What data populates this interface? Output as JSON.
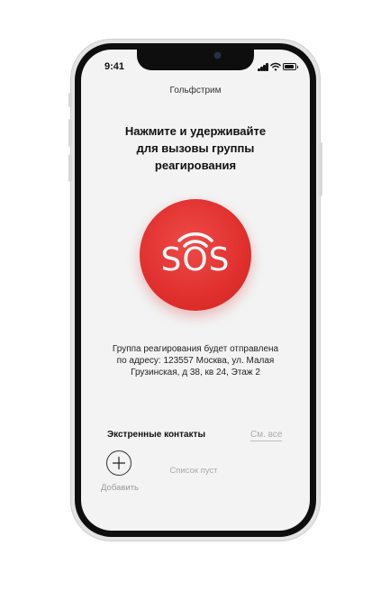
{
  "status_bar": {
    "time": "9:41",
    "icons": [
      "cellular-signal-icon",
      "wifi-icon",
      "battery-icon"
    ]
  },
  "app": {
    "title": "Гольфстрим"
  },
  "instruction": {
    "lines": [
      "Нажмите и удерживайте",
      "для вызовы группы",
      "реагирования"
    ]
  },
  "sos_button": {
    "label": "SOS",
    "icon": "wireless-signal-icon",
    "color": "#E3312F"
  },
  "address": {
    "lines": [
      "Группа реагирования будет отправлена",
      "по адресу: 123557 Москва, ул. Малая",
      "Грузинская, д 38, кв 24, Этаж 2"
    ]
  },
  "contacts": {
    "title": "Экстренные контакты",
    "see_all": "См. все",
    "add_label": "Добавить",
    "add_icon": "plus-icon",
    "empty_text": "Список пуст"
  },
  "colors": {
    "accent": "#E3312F",
    "background": "#F3F3F3",
    "muted_text": "#AAAAAA"
  }
}
